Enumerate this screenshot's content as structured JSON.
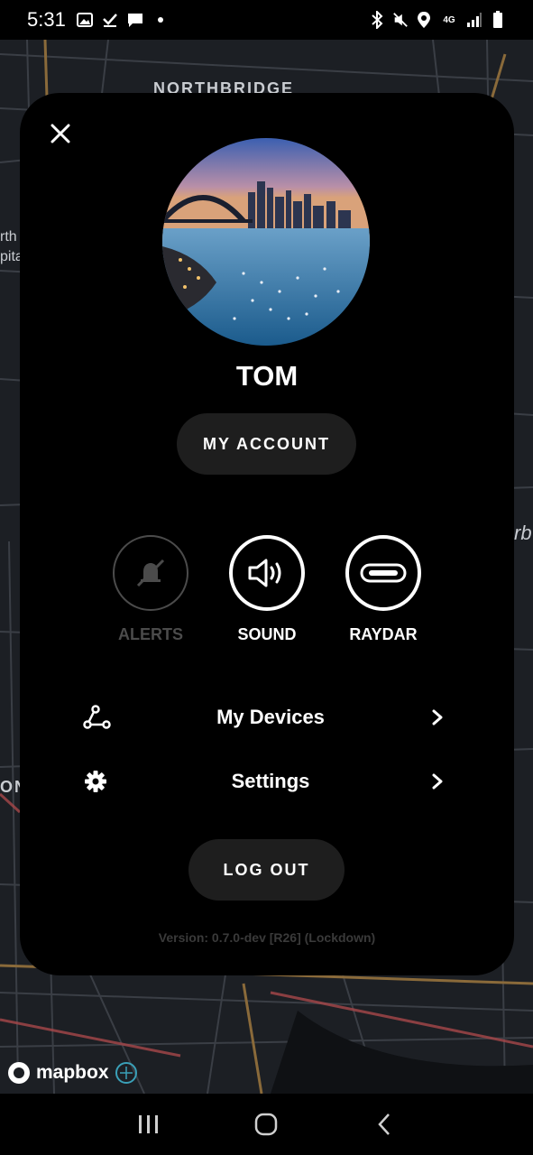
{
  "status_bar": {
    "time": "5:31",
    "icons_left": [
      "image-icon",
      "check-download-icon",
      "message-icon",
      "dot-icon"
    ],
    "icons_right": [
      "bluetooth-icon",
      "mute-icon",
      "location-icon",
      "network-4g-icon",
      "signal-icon",
      "battery-icon"
    ],
    "network_label": "4G"
  },
  "map": {
    "labels": {
      "northbridge": "NORTHBRIDGE",
      "north_partial_1": "rth",
      "north_partial_2": "pita",
      "right_partial": "rb",
      "left_partial": "ON"
    },
    "attribution": "mapbox"
  },
  "profile": {
    "close_icon": "close-icon",
    "name": "TOM",
    "avatar_description_icon": "avatar",
    "account_button": "MY ACCOUNT",
    "toggles": [
      {
        "label": "ALERTS",
        "icon": "bell-off-icon",
        "state": "off"
      },
      {
        "label": "SOUND",
        "icon": "speaker-icon",
        "state": "on"
      },
      {
        "label": "RAYDAR",
        "icon": "raydar-device-icon",
        "state": "on"
      }
    ],
    "menu": [
      {
        "label": "My Devices",
        "icon": "devices-network-icon"
      },
      {
        "label": "Settings",
        "icon": "gear-icon"
      }
    ],
    "logout_button": "LOG OUT",
    "version": "Version: 0.7.0-dev [R26] (Lockdown)"
  },
  "nav": {
    "buttons": [
      "recents-icon",
      "home-icon",
      "back-icon"
    ]
  },
  "colors": {
    "panel_bg": "#000000",
    "pill_bg": "#1e1e1e",
    "disabled": "#4b4b4b",
    "map_bg": "#1c1f24"
  }
}
